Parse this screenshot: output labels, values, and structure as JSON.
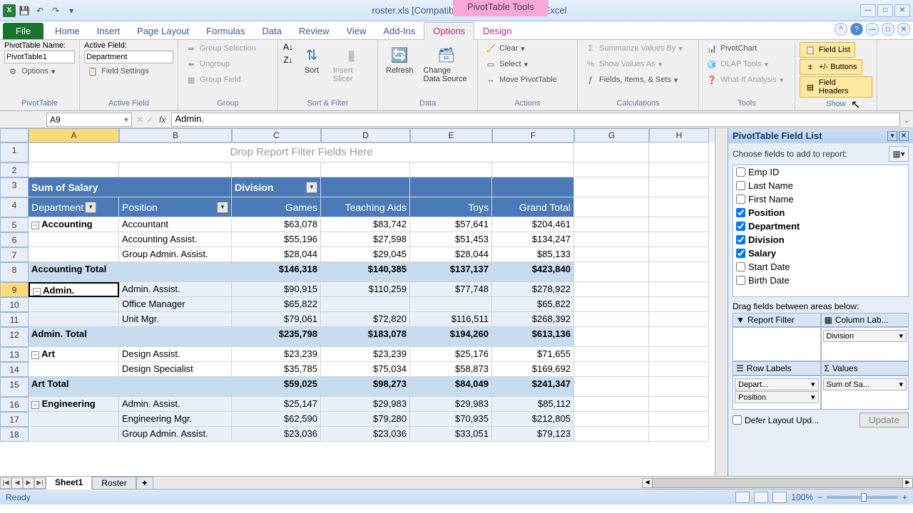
{
  "title": "roster.xls  [Compatibility Mode] - Microsoft Excel",
  "context_tab_title": "PivotTable Tools",
  "ribbon_tabs": [
    "Home",
    "Insert",
    "Page Layout",
    "Formulas",
    "Data",
    "Review",
    "View",
    "Add-Ins"
  ],
  "context_tabs": [
    "Options",
    "Design"
  ],
  "active_tab": "Options",
  "ribbon": {
    "pivottable": {
      "name_label": "PivotTable Name:",
      "name_value": "PivotTable1",
      "options": "Options",
      "group": "PivotTable"
    },
    "activefield": {
      "label": "Active Field:",
      "value": "Department",
      "settings": "Field Settings",
      "group": "Active Field"
    },
    "group": {
      "selection": "Group Selection",
      "ungroup": "Ungroup",
      "field": "Group Field",
      "group": "Group"
    },
    "sortfilter": {
      "sort": "Sort",
      "slicer": "Insert Slicer",
      "group": "Sort & Filter"
    },
    "data": {
      "refresh": "Refresh",
      "change": "Change Data Source",
      "group": "Data"
    },
    "actions": {
      "clear": "Clear",
      "select": "Select",
      "move": "Move PivotTable",
      "group": "Actions"
    },
    "calc": {
      "summarize": "Summarize Values By",
      "show": "Show Values As",
      "fields": "Fields, Items, & Sets",
      "group": "Calculations"
    },
    "tools": {
      "chart": "PivotChart",
      "olap": "OLAP Tools",
      "whatif": "What-If Analysis",
      "group": "Tools"
    },
    "show": {
      "fieldlist": "Field List",
      "buttons": "+/- Buttons",
      "headers": "Field Headers",
      "group": "Show"
    }
  },
  "namebox": "A9",
  "formula": "Admin.",
  "columns": [
    "A",
    "B",
    "C",
    "D",
    "E",
    "F",
    "G",
    "H"
  ],
  "drop_hint": "Drop Report Filter Fields Here",
  "pivot": {
    "measure": "Sum of Salary",
    "col_field": "Division",
    "row_fields": [
      "Department",
      "Position"
    ],
    "col_headers": [
      "Games",
      "Teaching Aids",
      "Toys",
      "Grand Total"
    ]
  },
  "rows": [
    {
      "r": 5,
      "dept": "Accounting",
      "pos": "Accountant",
      "vals": [
        "$63,078",
        "$83,742",
        "$57,641",
        "$204,461"
      ],
      "stripe": "a",
      "first": true
    },
    {
      "r": 6,
      "pos": "Accounting Assist.",
      "vals": [
        "$55,196",
        "$27,598",
        "$51,453",
        "$134,247"
      ],
      "stripe": "a"
    },
    {
      "r": 7,
      "pos": "Group Admin. Assist.",
      "vals": [
        "$28,044",
        "$29,045",
        "$28,044",
        "$85,133"
      ],
      "stripe": "a"
    },
    {
      "r": 8,
      "total": "Accounting Total",
      "vals": [
        "$146,318",
        "$140,385",
        "$137,137",
        "$423,840"
      ],
      "subtotal": true
    },
    {
      "r": 9,
      "dept": "Admin.",
      "pos": "Admin. Assist.",
      "vals": [
        "$90,915",
        "$110,259",
        "$77,748",
        "$278,922"
      ],
      "stripe": "b",
      "first": true,
      "selected": true
    },
    {
      "r": 10,
      "pos": "Office Manager",
      "vals": [
        "$65,822",
        "",
        "",
        "$65,822"
      ],
      "stripe": "b"
    },
    {
      "r": 11,
      "pos": "Unit Mgr.",
      "vals": [
        "$79,061",
        "$72,820",
        "$116,511",
        "$268,392"
      ],
      "stripe": "b"
    },
    {
      "r": 12,
      "total": "Admin. Total",
      "vals": [
        "$235,798",
        "$183,078",
        "$194,260",
        "$613,136"
      ],
      "subtotal": true
    },
    {
      "r": 13,
      "dept": "Art",
      "pos": "Design Assist.",
      "vals": [
        "$23,239",
        "$23,239",
        "$25,176",
        "$71,655"
      ],
      "stripe": "a",
      "first": true
    },
    {
      "r": 14,
      "pos": "Design Specialist",
      "vals": [
        "$35,785",
        "$75,034",
        "$58,873",
        "$169,692"
      ],
      "stripe": "a"
    },
    {
      "r": 15,
      "total": "Art Total",
      "vals": [
        "$59,025",
        "$98,273",
        "$84,049",
        "$241,347"
      ],
      "subtotal": true
    },
    {
      "r": 16,
      "dept": "Engineering",
      "pos": "Admin. Assist.",
      "vals": [
        "$25,147",
        "$29,983",
        "$29,983",
        "$85,112"
      ],
      "stripe": "b",
      "first": true
    },
    {
      "r": 17,
      "pos": "Engineering Mgr.",
      "vals": [
        "$62,590",
        "$79,280",
        "$70,935",
        "$212,805"
      ],
      "stripe": "b"
    },
    {
      "r": 18,
      "pos": "Group Admin. Assist.",
      "vals": [
        "$23,036",
        "$23,036",
        "$33,051",
        "$79,123"
      ],
      "stripe": "b"
    }
  ],
  "sheets": [
    "Sheet1",
    "Roster"
  ],
  "active_sheet": "Sheet1",
  "fieldlist": {
    "title": "PivotTable Field List",
    "hint": "Choose fields to add to report:",
    "fields": [
      {
        "name": "Emp ID",
        "checked": false
      },
      {
        "name": "Last Name",
        "checked": false
      },
      {
        "name": "First Name",
        "checked": false
      },
      {
        "name": "Position",
        "checked": true
      },
      {
        "name": "Department",
        "checked": true
      },
      {
        "name": "Division",
        "checked": true
      },
      {
        "name": "Salary",
        "checked": true
      },
      {
        "name": "Start Date",
        "checked": false
      },
      {
        "name": "Birth Date",
        "checked": false
      }
    ],
    "drag_hint": "Drag fields between areas below:",
    "areas": {
      "filter": "Report Filter",
      "columns": "Column Lab...",
      "rows": "Row Labels",
      "values": "Values"
    },
    "col_items": [
      "Division"
    ],
    "row_items": [
      "Depart...",
      "Position"
    ],
    "val_items": [
      "Sum of Sa..."
    ],
    "defer": "Defer Layout Upd...",
    "update": "Update"
  },
  "status": {
    "ready": "Ready",
    "zoom": "100%"
  }
}
